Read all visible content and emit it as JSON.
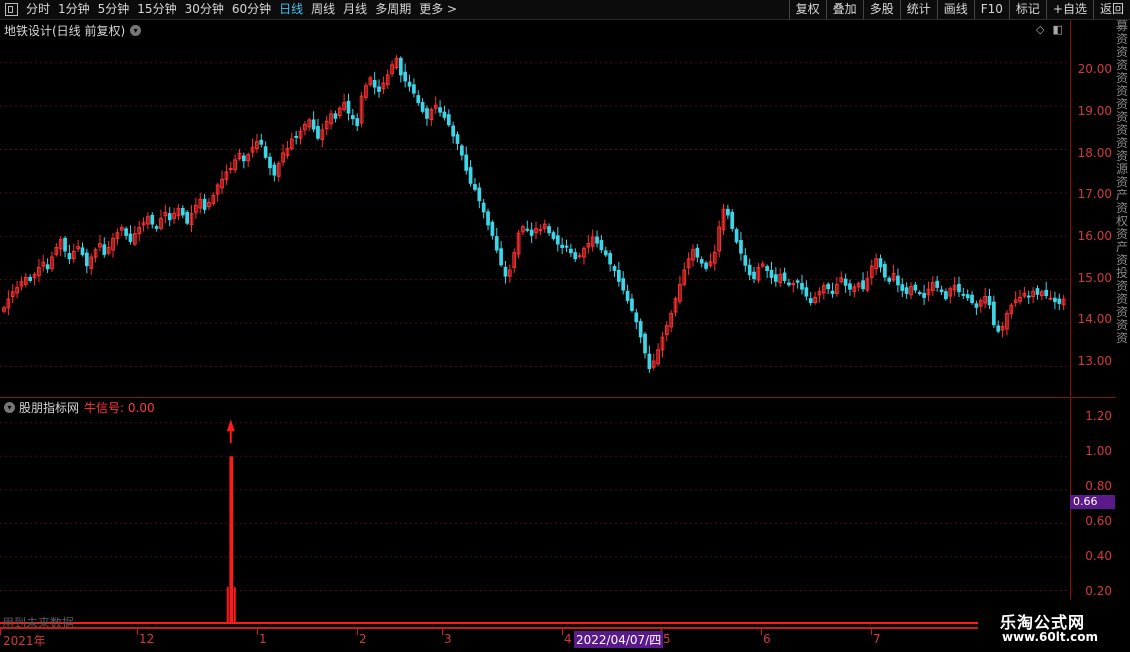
{
  "toolbar": {
    "left": [
      "分时",
      "1分钟",
      "5分钟",
      "15分钟",
      "30分钟",
      "60分钟",
      "日线",
      "周线",
      "月线",
      "多周期",
      "更多 >"
    ],
    "active": "日线",
    "right": [
      "复权",
      "叠加",
      "多股",
      "统计",
      "画线",
      "F10",
      "标记",
      "+自选",
      "返回"
    ]
  },
  "main_panel": {
    "title": "地铁设计(日线 前复权)",
    "y_ticks": [
      "20.00",
      "19.00",
      "18.00",
      "17.00",
      "16.00",
      "15.00",
      "14.00",
      "13.00"
    ]
  },
  "sub_panel": {
    "name": "股朋指标网",
    "signal_label": "牛信号: 0.00",
    "y_ticks": [
      "1.20",
      "1.00",
      "0.80",
      "0.60",
      "0.40",
      "0.20"
    ],
    "marker_value": "0.66",
    "note": "用到未来数据"
  },
  "x_axis": {
    "labels": [
      "2021年",
      "12",
      "1",
      "2",
      "3",
      "4",
      "5",
      "6",
      "7"
    ],
    "selected_date": "2022/04/07/四"
  },
  "right_strip": "募资资资资资资资资资资源资产资权资产资投资资资资资",
  "watermark": {
    "line1": "乐淘公式网",
    "line2": "www.60lt.com"
  },
  "colors": {
    "up": "#ff3030",
    "down": "#3dd6e8",
    "axis": "#d23a3a",
    "signal": "#ff1a1a"
  },
  "chart_data": {
    "type": "candlestick",
    "close": [
      14.35,
      14.55,
      14.72,
      14.82,
      14.95,
      15.05,
      14.98,
      15.12,
      15.28,
      15.4,
      15.25,
      15.52,
      15.74,
      15.92,
      15.66,
      15.48,
      15.65,
      15.76,
      15.58,
      15.32,
      15.52,
      15.69,
      15.83,
      15.58,
      15.74,
      15.95,
      16.08,
      16.2,
      16.02,
      15.88,
      16.06,
      16.2,
      16.31,
      16.45,
      16.28,
      16.18,
      16.41,
      16.55,
      16.38,
      16.53,
      16.64,
      16.49,
      16.3,
      16.52,
      16.71,
      16.85,
      16.62,
      16.78,
      16.94,
      17.18,
      17.31,
      17.48,
      17.56,
      17.76,
      17.91,
      17.74,
      17.88,
      18.05,
      18.18,
      18.12,
      17.82,
      17.58,
      17.41,
      17.68,
      17.92,
      18.02,
      18.24,
      18.29,
      18.42,
      18.58,
      18.68,
      18.47,
      18.26,
      18.45,
      18.65,
      18.82,
      18.72,
      18.95,
      19.08,
      18.84,
      18.71,
      18.55,
      19.23,
      19.47,
      19.65,
      19.44,
      19.34,
      19.53,
      19.72,
      19.95,
      20.1,
      19.72,
      19.58,
      19.46,
      19.3,
      19.08,
      18.88,
      18.72,
      18.92,
      19.02,
      18.86,
      18.74,
      18.57,
      18.31,
      18.14,
      17.87,
      17.52,
      17.22,
      17.08,
      16.82,
      16.56,
      16.26,
      16.02,
      15.68,
      15.34,
      15.08,
      15.22,
      15.62,
      16.07,
      16.22,
      16.14,
      16.02,
      16.18,
      16.15,
      16.28,
      16.08,
      15.95,
      15.82,
      15.74,
      15.76,
      15.62,
      15.48,
      15.55,
      15.72,
      15.83,
      15.98,
      15.84,
      15.69,
      15.57,
      15.36,
      15.21,
      14.96,
      14.76,
      14.52,
      14.29,
      14.03,
      13.68,
      13.31,
      12.95,
      13.12,
      13.38,
      13.67,
      13.94,
      14.22,
      14.56,
      14.89,
      15.22,
      15.48,
      15.69,
      15.52,
      15.38,
      15.26,
      15.41,
      15.63,
      16.21,
      16.62,
      16.49,
      16.18,
      15.87,
      15.61,
      15.33,
      15.11,
      15.02,
      15.28,
      15.36,
      15.21,
      15.05,
      14.96,
      15.12,
      14.98,
      14.88,
      14.91,
      14.94,
      14.78,
      14.62,
      14.47,
      14.59,
      14.72,
      14.86,
      14.79,
      14.68,
      14.89,
      15.04,
      14.87,
      14.78,
      14.83,
      14.91,
      14.79,
      15.02,
      15.31,
      15.48,
      15.29,
      15.06,
      14.96,
      15.14,
      14.88,
      14.75,
      14.68,
      14.84,
      14.76,
      14.68,
      14.59,
      14.78,
      14.93,
      14.82,
      14.72,
      14.56,
      14.79,
      14.86,
      14.72,
      14.65,
      14.58,
      14.47,
      14.36,
      14.52,
      14.61,
      14.42,
      13.96,
      13.81,
      13.92,
      14.22,
      14.41,
      14.53,
      14.59,
      14.68,
      14.61,
      14.73,
      14.66,
      14.72,
      14.63,
      14.57,
      14.49,
      14.45,
      14.55
    ],
    "ylim": [
      12.5,
      20.8
    ],
    "indicator": {
      "name": "股朋指标网",
      "signal_index": 52,
      "signal_value": 1.0,
      "ylim": [
        0,
        1.3
      ]
    }
  }
}
